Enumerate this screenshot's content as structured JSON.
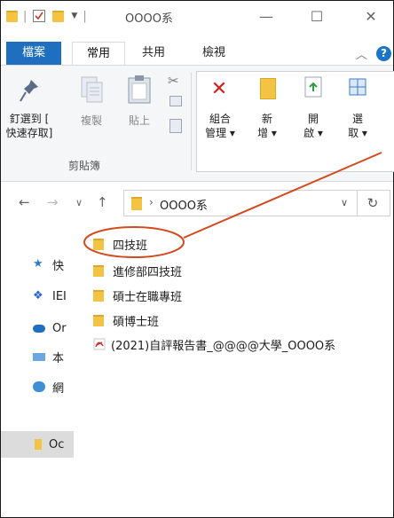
{
  "window": {
    "title": "OOOO系",
    "minimize": "—",
    "maximize": "☐",
    "close": "✕"
  },
  "tabs": {
    "file": "檔案",
    "home": "常用",
    "share": "共用",
    "view": "檢視",
    "help": "?"
  },
  "ribbon": {
    "pin_line1": "釘選到 [",
    "pin_line2": "快速存取]",
    "copy": "複製",
    "paste": "貼上",
    "organize_line1": "組合",
    "organize_line2": "管理 ▾",
    "new_line1": "新",
    "new_line2": "增 ▾",
    "open_line1": "開",
    "open_line2": "啟 ▾",
    "select_line1": "選",
    "select_line2": "取 ▾",
    "clipboard_group": "剪貼簿"
  },
  "address": {
    "path": "OOOO系"
  },
  "nav_pane": [
    {
      "label": "快",
      "icon": "pin-icon"
    },
    {
      "label": "IEI",
      "icon": "dropbox-icon"
    },
    {
      "label": "Or",
      "icon": "onedrive-icon"
    },
    {
      "label": "本",
      "icon": "pc-icon"
    },
    {
      "label": "網",
      "icon": "network-icon"
    },
    {
      "label": "Oc",
      "icon": "folder-icon"
    }
  ],
  "files": [
    {
      "name": "四技班",
      "icon": "folder-icon"
    },
    {
      "name": "進修部四技班",
      "icon": "folder-icon"
    },
    {
      "name": "碩士在職專班",
      "icon": "folder-icon"
    },
    {
      "name": "碩博士班",
      "icon": "folder-icon"
    },
    {
      "name": "(2021)自評報告書_@@@@大學_OOOO系",
      "icon": "pdf-icon"
    }
  ],
  "colors": {
    "accent": "#1e6fbf",
    "folder": "#f3c343",
    "annotation": "#d44a1e"
  }
}
